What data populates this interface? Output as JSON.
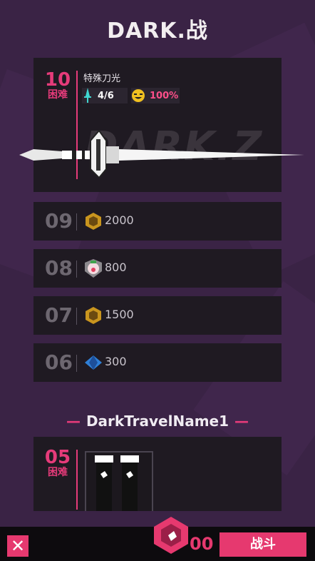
{
  "header": {
    "title": "DARK.战"
  },
  "featured": {
    "level": "10",
    "difficulty": "困难",
    "weapon_name": "特殊刀光",
    "blades": "4/6",
    "rate": "100%",
    "watermark": "DARK.Z"
  },
  "levels": [
    {
      "num": "09",
      "reward": "2000",
      "icon": "gold-badge-icon"
    },
    {
      "num": "08",
      "reward": "800",
      "icon": "pig-shield-icon"
    },
    {
      "num": "07",
      "reward": "1500",
      "icon": "gold-badge-icon"
    },
    {
      "num": "06",
      "reward": "300",
      "icon": "blue-gem-icon"
    }
  ],
  "section": {
    "title": "DarkTravelName1"
  },
  "next_stage": {
    "level": "05",
    "difficulty": "困难",
    "item_icon": "boots-icon"
  },
  "footer": {
    "gem_count": "00",
    "fight_label": "战斗",
    "close_icon": "close-icon"
  },
  "colors": {
    "accent": "#e6396f",
    "background": "#3a2345",
    "card": "#1f1a22"
  }
}
